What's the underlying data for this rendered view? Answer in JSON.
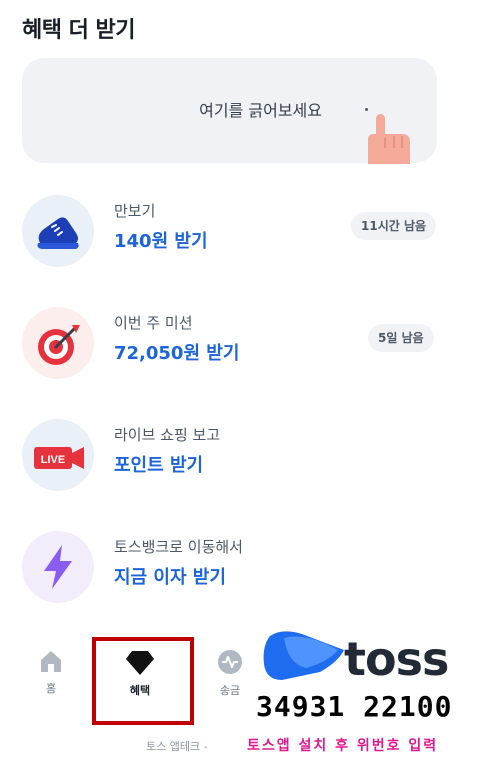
{
  "header": {
    "title": "혜택 더 받기"
  },
  "scratch_card": {
    "text": "여기를 긁어보세요",
    "icon": "pointing-hand-icon"
  },
  "benefits": [
    {
      "icon": "sneaker-icon",
      "title": "만보기",
      "reward": "140원 받기",
      "badge": "11시간 남음"
    },
    {
      "icon": "dart-target-icon",
      "title": "이번 주 미션",
      "reward": "72,050원 받기",
      "badge": "5일 남음"
    },
    {
      "icon": "live-camera-icon",
      "live_label": "LIVE",
      "title": "라이브 쇼핑 보고",
      "reward": "포인트 받기"
    },
    {
      "icon": "lightning-icon",
      "title": "토스뱅크로 이동해서",
      "reward": "지금 이자 받기"
    }
  ],
  "tabbar": {
    "items": [
      {
        "label": "홈",
        "icon": "home-icon"
      },
      {
        "label": "혜택",
        "icon": "gem-icon",
        "active": true
      },
      {
        "label": "송금",
        "icon": "transfer-icon"
      }
    ]
  },
  "overlay": {
    "brand": "toss",
    "phone": "34931 22100",
    "footer_left": "토스 앱테크 -",
    "footer_right": "토스앱 설치 후 위번호 입력"
  },
  "colors": {
    "accent_blue": "#1b64da",
    "highlight_red": "#c00000",
    "footer_pink": "#e3188d",
    "card_bg": "#f0f2f5"
  }
}
